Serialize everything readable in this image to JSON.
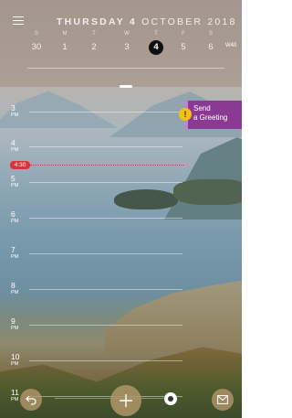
{
  "header": {
    "date_weekday_day": "THURSDAY 4",
    "date_month_year": "OCTOBER 2018",
    "week_label": "W40",
    "days": [
      {
        "name": "S",
        "num": "30"
      },
      {
        "name": "M",
        "num": "1"
      },
      {
        "name": "T",
        "num": "2"
      },
      {
        "name": "W",
        "num": "3"
      },
      {
        "name": "T",
        "num": "4"
      },
      {
        "name": "F",
        "num": "5"
      },
      {
        "name": "S",
        "num": "6"
      }
    ],
    "selected_day": "4"
  },
  "timeline": {
    "hours": [
      {
        "num": "3",
        "period": "PM"
      },
      {
        "num": "4",
        "period": "PM"
      },
      {
        "num": "5",
        "period": "PM"
      },
      {
        "num": "6",
        "period": "PM"
      },
      {
        "num": "7",
        "period": "PM"
      },
      {
        "num": "8",
        "period": "PM"
      },
      {
        "num": "9",
        "period": "PM"
      },
      {
        "num": "10",
        "period": "PM"
      },
      {
        "num": "11",
        "period": "PM"
      }
    ],
    "now_label": "4:30"
  },
  "event": {
    "title_line1": "Send",
    "title_line2": "a Greeting",
    "alert_symbol": "!",
    "color": "#8b3a93"
  },
  "toolbar": {
    "back_icon": "undo-icon",
    "add_icon": "plus-icon",
    "toggle_icon": "toggle-icon",
    "mail_icon": "mail-icon"
  }
}
